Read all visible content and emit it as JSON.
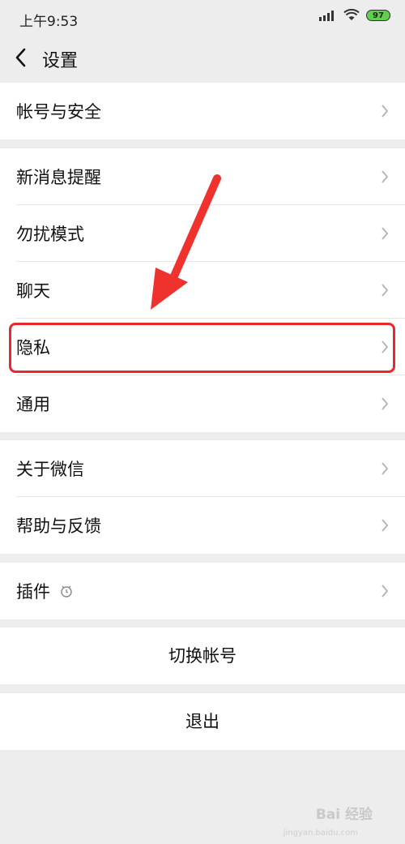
{
  "status": {
    "time": "上午9:53",
    "battery": "97"
  },
  "nav": {
    "title": "设置"
  },
  "groups": [
    {
      "items": [
        {
          "label": "帐号与安全"
        }
      ]
    },
    {
      "items": [
        {
          "label": "新消息提醒"
        },
        {
          "label": "勿扰模式"
        },
        {
          "label": "聊天"
        },
        {
          "label": "隐私"
        },
        {
          "label": "通用"
        }
      ]
    },
    {
      "items": [
        {
          "label": "关于微信"
        },
        {
          "label": "帮助与反馈"
        }
      ]
    },
    {
      "items": [
        {
          "label": "插件"
        }
      ]
    }
  ],
  "actions": {
    "switch_account": "切换帐号",
    "logout": "退出"
  },
  "highlight_color": "#e8282d",
  "watermark": {
    "text": "Bai 经验",
    "sub": "jingyan.baidu.com"
  }
}
